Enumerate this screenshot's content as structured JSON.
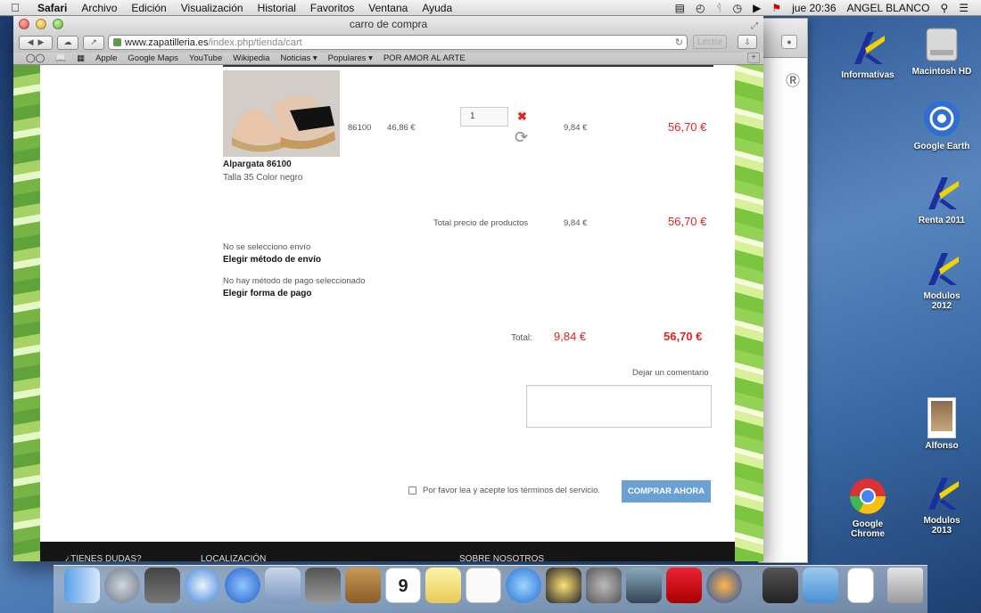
{
  "menubar": {
    "app": "Safari",
    "items": [
      "Archivo",
      "Edición",
      "Visualización",
      "Historial",
      "Favoritos",
      "Ventana",
      "Ayuda"
    ],
    "clock": "jue 20:36",
    "user": "ANGEL BLANCO"
  },
  "window": {
    "title": "carro de compra",
    "url_host": "www.zapatilleria.es",
    "url_path": "/index.php/tienda/cart",
    "reader_label": "Lector"
  },
  "bookmarks": [
    "Apple",
    "Google Maps",
    "YouTube",
    "Wikipedia",
    "Noticias ▾",
    "Populares ▾",
    "POR AMOR AL ARTE"
  ],
  "cart": {
    "product_name": "Alpargata 86100",
    "product_variant": "Talla 35 Color negro",
    "ref": "86100",
    "unit_price": "46,86 €",
    "quantity": "1",
    "tax": "9,84 €",
    "line_total": "56,70 €",
    "subtotal_label": "Total precio de productos",
    "subtotal_tax": "9,84 €",
    "subtotal_total": "56,70 €",
    "shipping_status": "No se selecciono envío",
    "shipping_link": "Elegir método de envío",
    "payment_status": "No hay método de pago seleccionado",
    "payment_link": "Elegir forma de pago",
    "total_label": "Total:",
    "total_tax": "9,84 €",
    "total_amount": "56,70 €",
    "comment_label": "Dejar un comentario",
    "terms_label": "Por favor lea y acepte los términos del servicio.",
    "buy_button": "COMPRAR AHORA"
  },
  "footer": [
    "¿TIENES DUDAS?",
    "LOCALIZACIÓN",
    "SOBRE NOSOTROS"
  ],
  "desktop_icons": [
    "Informativas",
    "Macintosh HD",
    "Google Earth",
    "Renta 2011",
    "Modulos 2012",
    "Alfonso",
    "Google Chrome",
    "Modulos 2013"
  ],
  "colors": {
    "price_red": "#e02323",
    "buy_blue": "#6aa0d4",
    "aeat_blue": "#1b2f9e",
    "aeat_yellow": "#f2d300"
  }
}
